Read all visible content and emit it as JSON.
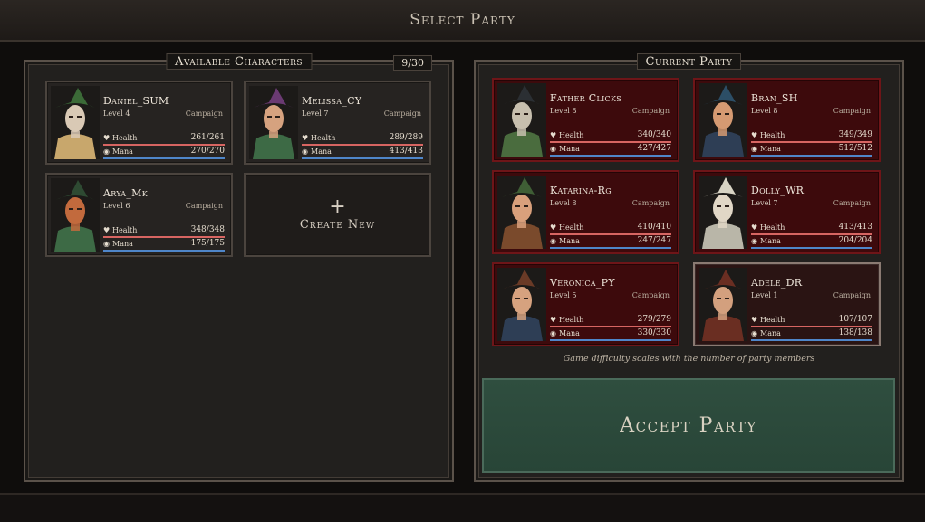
{
  "title": "Select Party",
  "available": {
    "title": "Available Characters",
    "count": "9/30",
    "create_label": "Create New",
    "create_icon": "plus-icon",
    "characters": [
      {
        "name": "Daniel_SUM",
        "level": "Level 4",
        "mode": "Campaign",
        "health_label": "Health",
        "health": "261/261",
        "health_frac": 1.0,
        "mana_label": "Mana",
        "mana": "270/270",
        "mana_frac": 1.0,
        "hat": "#3b6a37",
        "shirt": "#c8a76c",
        "skin": "#d9c9b5"
      },
      {
        "name": "Melissa_CY",
        "level": "Level 7",
        "mode": "Campaign",
        "health_label": "Health",
        "health": "289/289",
        "health_frac": 1.0,
        "mana_label": "Mana",
        "mana": "413/413",
        "mana_frac": 1.0,
        "hat": "#6a3a72",
        "shirt": "#3d6a45",
        "skin": "#d6a27f"
      },
      {
        "name": "Arya_Mk",
        "level": "Level 6",
        "mode": "Campaign",
        "health_label": "Health",
        "health": "348/348",
        "health_frac": 1.0,
        "mana_label": "Mana",
        "mana": "175/175",
        "mana_frac": 1.0,
        "hat": "#2e4a32",
        "shirt": "#3d6a45",
        "skin": "#c26a3d"
      }
    ]
  },
  "party": {
    "title": "Current Party",
    "hint": "Game difficulty scales with the number of party members",
    "accept_label": "Accept Party",
    "members": [
      {
        "name": "Father Clicks",
        "level": "Level 8",
        "mode": "Campaign",
        "health_label": "Health",
        "health": "340/340",
        "health_frac": 1.0,
        "mana_label": "Mana",
        "mana": "427/427",
        "mana_frac": 1.0,
        "hat": "#2b2f33",
        "shirt": "#4a6c3e",
        "skin": "#c7bfae"
      },
      {
        "name": "Bran_SH",
        "level": "Level 8",
        "mode": "Campaign",
        "health_label": "Health",
        "health": "349/349",
        "health_frac": 1.0,
        "mana_label": "Mana",
        "mana": "512/512",
        "mana_frac": 1.0,
        "hat": "#2c4e66",
        "shirt": "#2e3e55",
        "skin": "#d59a72"
      },
      {
        "name": "Katarina-Rg",
        "level": "Level 8",
        "mode": "Campaign",
        "health_label": "Health",
        "health": "410/410",
        "health_frac": 1.0,
        "mana_label": "Mana",
        "mana": "247/247",
        "mana_frac": 1.0,
        "hat": "#3f5e35",
        "shirt": "#7a4a2c",
        "skin": "#d9a07c"
      },
      {
        "name": "Dolly_WR",
        "level": "Level 7",
        "mode": "Campaign",
        "health_label": "Health",
        "health": "413/413",
        "health_frac": 1.0,
        "mana_label": "Mana",
        "mana": "204/204",
        "mana_frac": 1.0,
        "hat": "#d8d4c4",
        "shirt": "#b9b6a8",
        "skin": "#e1d7c6"
      },
      {
        "name": "Veronica_PY",
        "level": "Level 5",
        "mode": "Campaign",
        "health_label": "Health",
        "health": "279/279",
        "health_frac": 1.0,
        "mana_label": "Mana",
        "mana": "330/330",
        "mana_frac": 1.0,
        "hat": "#6a3a26",
        "shirt": "#2e3e55",
        "skin": "#d6a27f"
      },
      {
        "name": "Adele_DR",
        "level": "Level 1",
        "mode": "Campaign",
        "health_label": "Health",
        "health": "107/107",
        "health_frac": 1.0,
        "mana_label": "Mana",
        "mana": "138/138",
        "mana_frac": 1.0,
        "hat": "#6a2e22",
        "shirt": "#6a2e22",
        "skin": "#d3a07e"
      }
    ]
  }
}
